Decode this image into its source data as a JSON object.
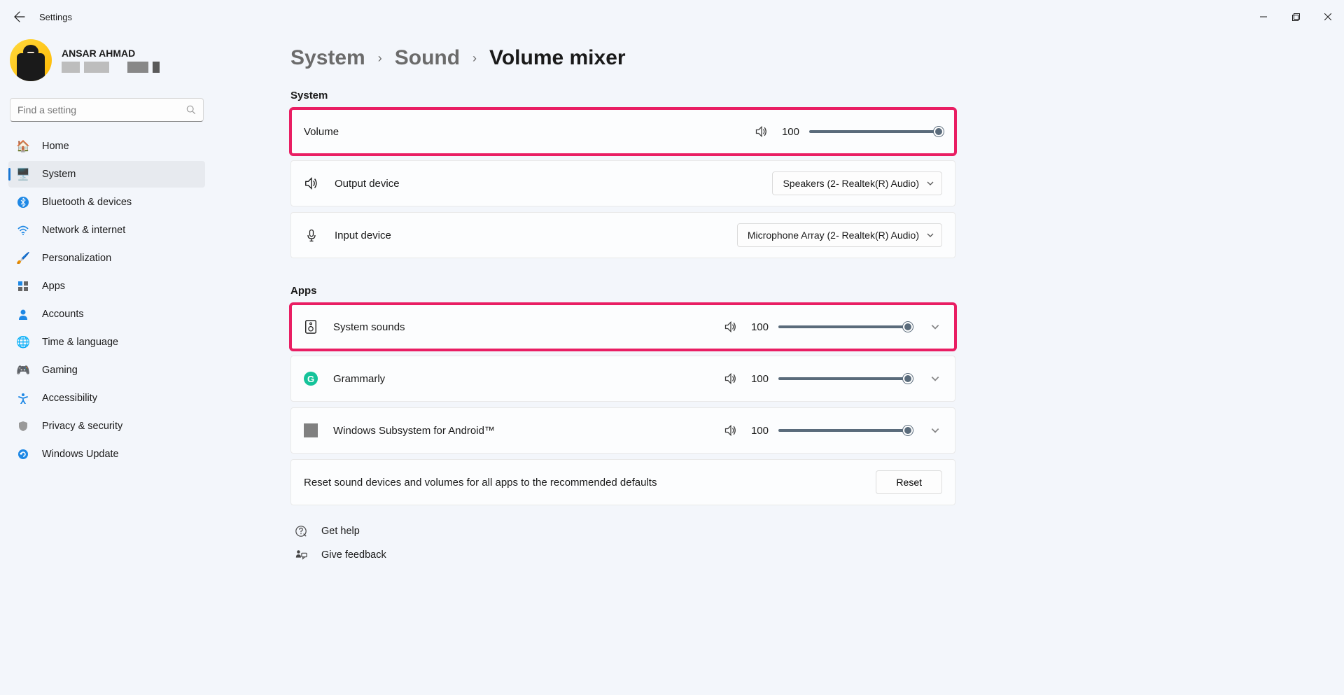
{
  "app_title": "Settings",
  "user": {
    "name": "ANSAR AHMAD"
  },
  "search": {
    "placeholder": "Find a setting"
  },
  "nav": [
    {
      "label": "Home"
    },
    {
      "label": "System"
    },
    {
      "label": "Bluetooth & devices"
    },
    {
      "label": "Network & internet"
    },
    {
      "label": "Personalization"
    },
    {
      "label": "Apps"
    },
    {
      "label": "Accounts"
    },
    {
      "label": "Time & language"
    },
    {
      "label": "Gaming"
    },
    {
      "label": "Accessibility"
    },
    {
      "label": "Privacy & security"
    },
    {
      "label": "Windows Update"
    }
  ],
  "breadcrumb": {
    "l1": "System",
    "l2": "Sound",
    "current": "Volume mixer"
  },
  "sections": {
    "system": {
      "label": "System",
      "volume": {
        "label": "Volume",
        "value": "100"
      },
      "output": {
        "label": "Output device",
        "selected": "Speakers (2- Realtek(R) Audio)"
      },
      "input": {
        "label": "Input device",
        "selected": "Microphone Array (2- Realtek(R) Audio)"
      }
    },
    "apps": {
      "label": "Apps",
      "items": [
        {
          "label": "System sounds",
          "value": "100"
        },
        {
          "label": "Grammarly",
          "value": "100"
        },
        {
          "label": "Windows Subsystem for Android™",
          "value": "100"
        }
      ],
      "reset": {
        "label": "Reset sound devices and volumes for all apps to the recommended defaults",
        "button": "Reset"
      }
    }
  },
  "help": {
    "get_help": "Get help",
    "feedback": "Give feedback"
  }
}
